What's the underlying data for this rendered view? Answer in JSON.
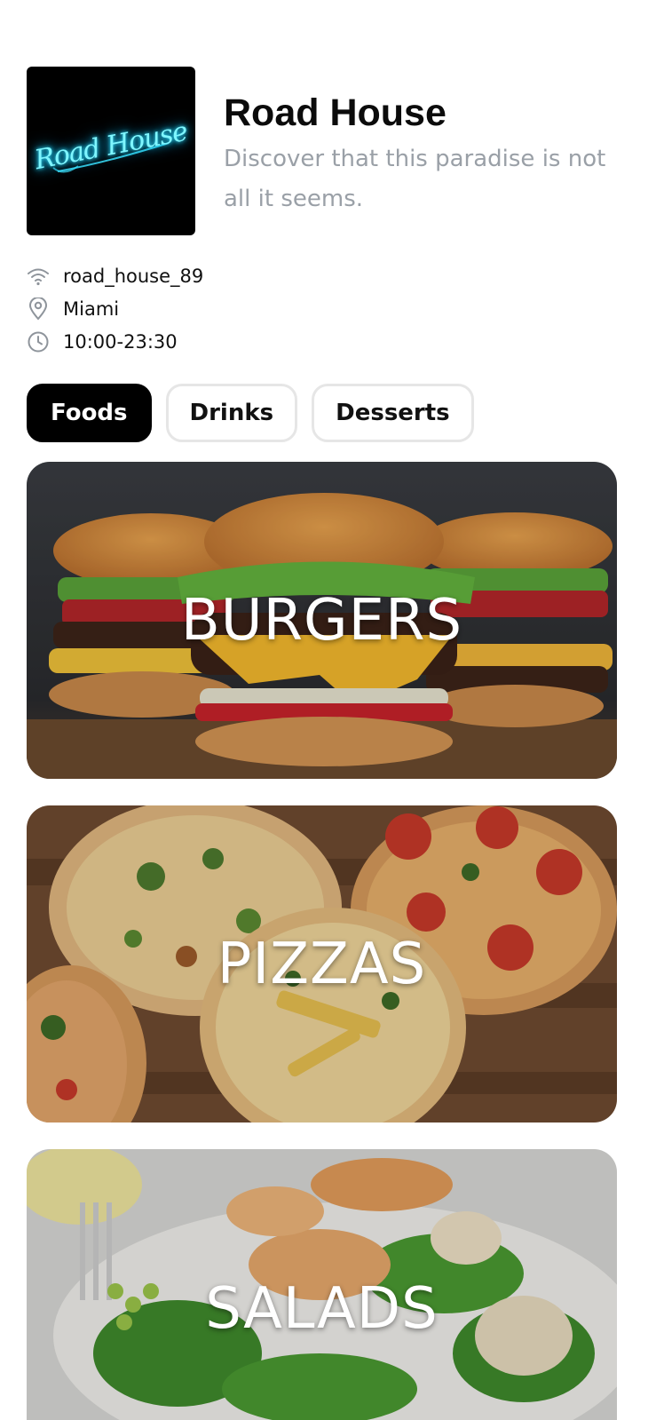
{
  "restaurant": {
    "name": "Road House",
    "tagline": "Discover that this paradise is not all it seems.",
    "logo_text": "Road House",
    "wifi": "road_house_89",
    "location": "Miami",
    "hours": "10:00-23:30"
  },
  "icons": {
    "wifi": "wifi-icon",
    "location": "location-pin-icon",
    "hours": "clock-icon"
  },
  "tabs": [
    {
      "label": "Foods",
      "active": true
    },
    {
      "label": "Drinks",
      "active": false
    },
    {
      "label": "Desserts",
      "active": false
    }
  ],
  "categories": [
    {
      "label": "BURGERS"
    },
    {
      "label": "PIZZAS"
    },
    {
      "label": "SALADS"
    }
  ],
  "colors": {
    "accent": "#000000",
    "tagline": "#9aa0a7",
    "logo_glow": "#2fe4ff"
  }
}
